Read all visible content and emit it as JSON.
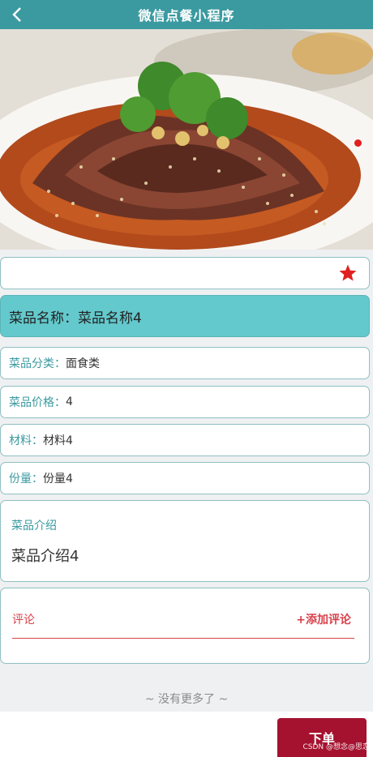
{
  "header": {
    "title": "微信点餐小程序"
  },
  "dish": {
    "name_label": "菜品名称：",
    "name_value": "菜品名称4",
    "fields": [
      {
        "label": "菜品分类：",
        "value": "面食类"
      },
      {
        "label": "菜品价格：",
        "value": "4"
      },
      {
        "label": "材料：",
        "value": "材料4"
      },
      {
        "label": "份量：",
        "value": "份量4"
      }
    ],
    "intro_title": "菜品介绍",
    "intro_text": "菜品介绍4"
  },
  "comments": {
    "title": "评论",
    "add_label": "+添加评论"
  },
  "list": {
    "no_more": "~ 没有更多了 ~"
  },
  "footer": {
    "order_button": "下单"
  },
  "watermark": "CSDN @想念@思恋",
  "colors": {
    "accent": "#3a9aa0",
    "header": "#3a9aa0",
    "name_bg": "#63c9cd",
    "danger": "#d8404a",
    "order_button": "#a5122f",
    "star": "#e02020"
  },
  "icons": {
    "back": "chevron-left-icon",
    "favorite": "star-icon"
  }
}
